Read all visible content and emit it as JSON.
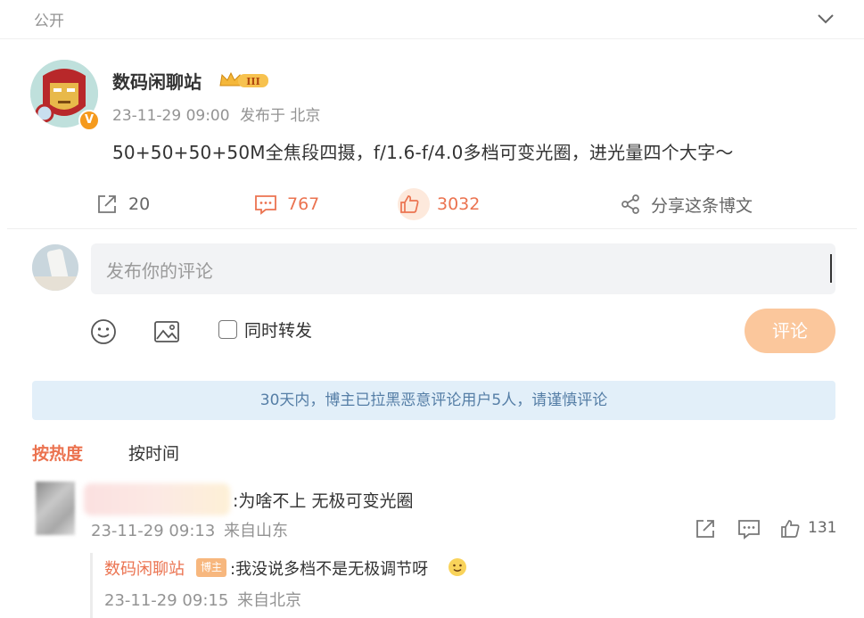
{
  "topbar": {
    "visibility": "公开"
  },
  "post": {
    "author": "数码闲聊站",
    "level_badge": "III",
    "verified_mark": "V",
    "time": "23-11-29 09:00",
    "location": "发布于 北京",
    "text": "50+50+50+50M全焦段四摄，f/1.6-f/4.0多档可变光圈，进光量四个大字～",
    "forwards": "20",
    "comments": "767",
    "likes": "3032",
    "share_label": "分享这条博文"
  },
  "composer": {
    "placeholder": "发布你的评论",
    "repost_label": "同时转发",
    "submit_label": "评论"
  },
  "notice": "30天内，博主已拉黑恶意评论用户5人，请谨慎评论",
  "sort": {
    "hot": "按热度",
    "time": "按时间"
  },
  "comments": [
    {
      "text": ":为啥不上 无极可变光圈",
      "time": "23-11-29 09:13",
      "location": "来自山东",
      "likes": "131",
      "reply": {
        "author": "数码闲聊站",
        "tag": "博主",
        "text": ":我没说多档不是无极调节呀",
        "time": "23-11-29 09:15",
        "location": "来自北京"
      }
    }
  ],
  "colors": {
    "accent": "#eb7350",
    "notice_bg": "#e2eff9",
    "notice_text": "#557ea6",
    "submit_bg": "#fbc79c"
  },
  "icons": [
    "chevron-down-icon",
    "forward-icon",
    "comment-icon",
    "like-icon",
    "share-icon",
    "emoji-icon",
    "image-icon",
    "smiling-face-icon"
  ]
}
